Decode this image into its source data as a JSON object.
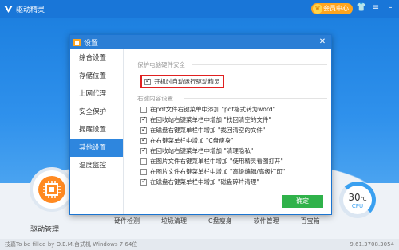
{
  "app": {
    "title": "驱动精灵",
    "vip_label": "会员中心",
    "brand_color": "#1976d8"
  },
  "dialog": {
    "title": "设置",
    "nav": [
      {
        "label": "综合设置"
      },
      {
        "label": "存储位置"
      },
      {
        "label": "上网代理"
      },
      {
        "label": "安全保护"
      },
      {
        "label": "提醒设置"
      },
      {
        "label": "其他设置"
      },
      {
        "label": "温度监控"
      }
    ],
    "active_nav": "其他设置",
    "section_boot": {
      "title": "保护电脑硬件安全",
      "option": {
        "label": "开机时自动运行驱动精灵",
        "checked": true
      }
    },
    "section_menu": {
      "title": "右键内容设置",
      "options": [
        {
          "label": "在pdf文件右键菜单中添加 \"pdf格式转为word\"",
          "checked": false
        },
        {
          "label": "在回收站右键菜单栏中增加 \"找回清空的文件\"",
          "checked": true
        },
        {
          "label": "在磁盘右键菜单栏中增加 \"找回清空的文件\"",
          "checked": true
        },
        {
          "label": "在右键菜单栏中增加 \"C盘瘦身\"",
          "checked": true
        },
        {
          "label": "在回收站右键菜单栏中增加 \"清理隐私\"",
          "checked": true
        },
        {
          "label": "在图片文件右键菜单栏中增加 \"使用精灵看图打开\"",
          "checked": false
        },
        {
          "label": "在图片文件右键菜单栏中增加 \"高级编辑/高级打印\"",
          "checked": false
        },
        {
          "label": "在磁盘右键菜单栏中增加 \"磁盘碎片清理\"",
          "checked": true
        }
      ]
    },
    "ok_label": "确定"
  },
  "main": {
    "driver_label": "驱动管理",
    "features": [
      "硬件检测",
      "垃圾清理",
      "C盘瘦身",
      "软件管理",
      "百宝箱"
    ],
    "cpu_temp": "30",
    "cpu_temp_unit": "℃",
    "cpu_label": "CPU"
  },
  "status": {
    "left": "技嘉To be filled by O.E.M.台式机  Windows 7 64位",
    "version": "9.61.3708.3054"
  }
}
